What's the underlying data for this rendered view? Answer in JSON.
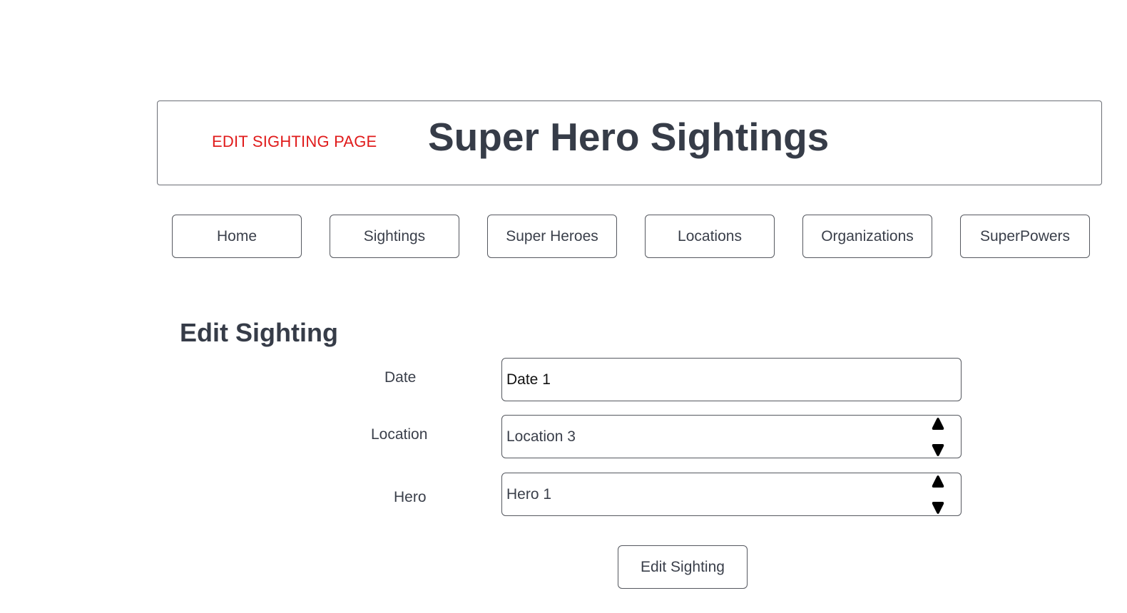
{
  "header": {
    "page_tag": "EDIT SIGHTING PAGE",
    "title": "Super Hero Sightings"
  },
  "nav": {
    "items": [
      {
        "label": "Home"
      },
      {
        "label": "Sightings"
      },
      {
        "label": "Super Heroes"
      },
      {
        "label": "Locations"
      },
      {
        "label": "Organizations"
      },
      {
        "label": "SuperPowers"
      }
    ]
  },
  "form": {
    "title": "Edit Sighting",
    "date": {
      "label": "Date",
      "value": "Date 1"
    },
    "location": {
      "label": "Location",
      "value": "Location 3"
    },
    "hero": {
      "label": "Hero",
      "value": "Hero 1"
    },
    "submit_label": "Edit Sighting"
  },
  "colors": {
    "page_tag": "#e01b1b",
    "title": "#363c48",
    "text": "#3a3f4a",
    "border": "#55585f"
  },
  "icons": {
    "spinner_up": "triangle-up-icon",
    "spinner_down": "triangle-down-icon"
  }
}
